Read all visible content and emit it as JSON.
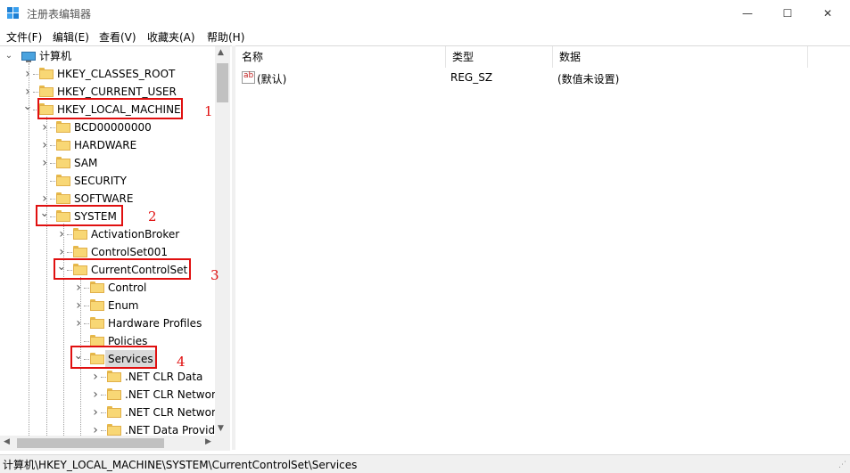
{
  "window": {
    "title": "注册表编辑器",
    "controls": {
      "minimize": "—",
      "maximize": "☐",
      "close": "✕"
    }
  },
  "menu": [
    "文件(F)",
    "编辑(E)",
    "查看(V)",
    "收藏夹(A)",
    "帮助(H)"
  ],
  "tree": {
    "root": "计算机",
    "items": [
      {
        "label": "HKEY_CLASSES_ROOT",
        "level": 1,
        "state": "collapsed"
      },
      {
        "label": "HKEY_CURRENT_USER",
        "level": 1,
        "state": "collapsed"
      },
      {
        "label": "HKEY_LOCAL_MACHINE",
        "level": 1,
        "state": "expanded"
      },
      {
        "label": "BCD00000000",
        "level": 2,
        "state": "collapsed"
      },
      {
        "label": "HARDWARE",
        "level": 2,
        "state": "collapsed"
      },
      {
        "label": "SAM",
        "level": 2,
        "state": "collapsed"
      },
      {
        "label": "SECURITY",
        "level": 2,
        "state": "leaf"
      },
      {
        "label": "SOFTWARE",
        "level": 2,
        "state": "collapsed"
      },
      {
        "label": "SYSTEM",
        "level": 2,
        "state": "expanded"
      },
      {
        "label": "ActivationBroker",
        "level": 3,
        "state": "collapsed"
      },
      {
        "label": "ControlSet001",
        "level": 3,
        "state": "collapsed"
      },
      {
        "label": "CurrentControlSet",
        "level": 3,
        "state": "expanded"
      },
      {
        "label": "Control",
        "level": 4,
        "state": "collapsed"
      },
      {
        "label": "Enum",
        "level": 4,
        "state": "collapsed"
      },
      {
        "label": "Hardware Profiles",
        "level": 4,
        "state": "collapsed"
      },
      {
        "label": "Policies",
        "level": 4,
        "state": "leaf"
      },
      {
        "label": "Services",
        "level": 4,
        "state": "expanded",
        "selected": true
      },
      {
        "label": ".NET CLR Data",
        "level": 5,
        "state": "collapsed"
      },
      {
        "label": ".NET CLR Networ",
        "level": 5,
        "state": "collapsed"
      },
      {
        "label": ".NET CLR Networ",
        "level": 5,
        "state": "collapsed"
      },
      {
        "label": ".NET Data Provid",
        "level": 5,
        "state": "collapsed"
      }
    ]
  },
  "annotations": [
    "1",
    "2",
    "3",
    "4"
  ],
  "list": {
    "columns": [
      "名称",
      "类型",
      "数据"
    ],
    "rows": [
      {
        "icon": "string-value-icon",
        "icon_text": "ab",
        "name": "(默认)",
        "type": "REG_SZ",
        "data": "(数值未设置)"
      }
    ]
  },
  "status": "计算机\\HKEY_LOCAL_MACHINE\\SYSTEM\\CurrentControlSet\\Services",
  "colors": {
    "folder": "#f8d775",
    "selection": "#d9d9d9",
    "annotation": "#e01010"
  }
}
